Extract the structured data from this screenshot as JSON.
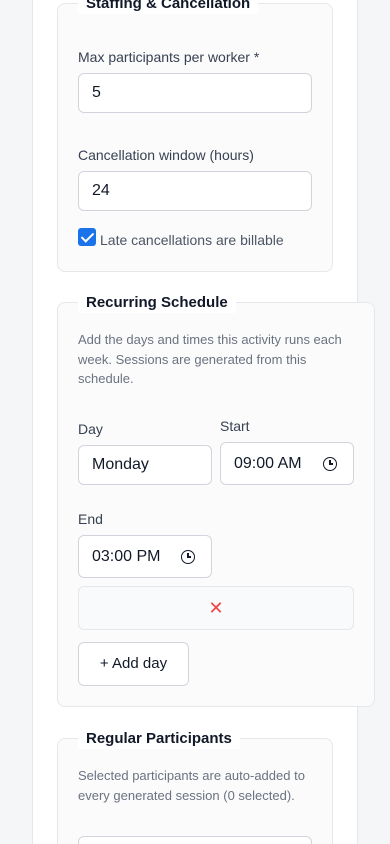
{
  "staffing": {
    "legend": "Staffing & Cancellation",
    "max_participants_label": "Max participants per worker *",
    "max_participants_value": "5",
    "cancellation_window_label": "Cancellation window (hours)",
    "cancellation_window_value": "24",
    "late_cancellations_label": "Late cancellations are billable",
    "late_cancellations_checked": true
  },
  "schedule": {
    "legend": "Recurring Schedule",
    "help": "Add the days and times this activity runs each week. Sessions are generated from this schedule.",
    "day_label": "Day",
    "day_value": "Monday",
    "start_label": "Start",
    "start_value": "09:00 AM",
    "end_label": "End",
    "end_value": "03:00 PM",
    "remove_icon": "close-icon",
    "add_day_label": "+ Add day"
  },
  "participants": {
    "legend": "Regular Participants",
    "help": "Selected participants are auto-added to every generated session (0 selected)."
  },
  "colors": {
    "accent": "#1a73e8",
    "danger": "#ef4444"
  }
}
